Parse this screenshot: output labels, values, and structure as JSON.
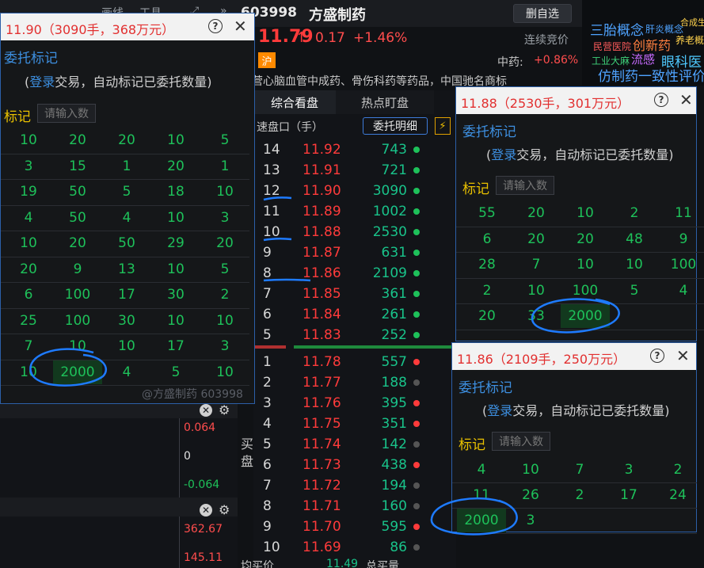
{
  "topbar": {
    "menu": [
      "画线",
      "工具"
    ],
    "code": "603998",
    "name": "方盛制药",
    "remove_btn": "删自选"
  },
  "quote": {
    "price": "11.79",
    "arrow": "↑",
    "change": "0.17",
    "change_pct": "+1.46%",
    "auction": "连续竞价",
    "exchange": "沪",
    "sector_label": "中药:",
    "sector_pct": "+0.86%",
    "business": "营心脑血管中成药、骨伤科药等药品，中国驰名商标"
  },
  "cloud": [
    {
      "t": "三胎概念",
      "c": "#4fa3ff"
    },
    {
      "t": "肝炎概念",
      "c": "#4fa3ff"
    },
    {
      "t": "合成生",
      "c": "#ffd24d"
    },
    {
      "t": "民营医院",
      "c": "#ff5b5b"
    },
    {
      "t": "创新药",
      "c": "#ff7f3f"
    },
    {
      "t": "养老概",
      "c": "#ffd24d"
    },
    {
      "t": "工业大麻",
      "c": "#3fd27a"
    },
    {
      "t": "流感",
      "c": "#c86bff"
    },
    {
      "t": "眼科医",
      "c": "#4fc9ff"
    },
    {
      "t": "仿制药一致性评价",
      "c": "#4fa3ff"
    }
  ],
  "tabs": [
    "综合看盘",
    "热点盯盘"
  ],
  "orderbook": {
    "header": "速盘口（手）",
    "detail_btn": "委托明细",
    "bolt": "⚡",
    "asks": [
      {
        "lv": "14",
        "px": "11.92",
        "vol": "743",
        "dot": "g"
      },
      {
        "lv": "13",
        "px": "11.91",
        "vol": "721",
        "dot": "g"
      },
      {
        "lv": "12",
        "px": "11.90",
        "vol": "3090",
        "dot": "g"
      },
      {
        "lv": "11",
        "px": "11.89",
        "vol": "1002",
        "dot": "g"
      },
      {
        "lv": "10",
        "px": "11.88",
        "vol": "2530",
        "dot": "g"
      },
      {
        "lv": "9",
        "px": "11.87",
        "vol": "631",
        "dot": "g"
      },
      {
        "lv": "8",
        "px": "11.86",
        "vol": "2109",
        "dot": "g"
      },
      {
        "lv": "7",
        "px": "11.85",
        "vol": "361",
        "dot": "g"
      },
      {
        "lv": "6",
        "px": "11.84",
        "vol": "261",
        "dot": "g"
      },
      {
        "lv": "5",
        "px": "11.83",
        "vol": "252",
        "dot": "g"
      }
    ],
    "bids": [
      {
        "lv": "1",
        "px": "11.78",
        "vol": "557",
        "dot": "r"
      },
      {
        "lv": "2",
        "px": "11.77",
        "vol": "188",
        "dot": "k"
      },
      {
        "lv": "3",
        "px": "11.76",
        "vol": "395",
        "dot": "r"
      },
      {
        "lv": "4",
        "px": "11.75",
        "vol": "351",
        "dot": "r"
      },
      {
        "lv": "5",
        "px": "11.74",
        "vol": "142",
        "dot": "k"
      },
      {
        "lv": "6",
        "px": "11.73",
        "vol": "438",
        "dot": "r"
      },
      {
        "lv": "7",
        "px": "11.72",
        "vol": "194",
        "dot": "k"
      },
      {
        "lv": "8",
        "px": "11.71",
        "vol": "160",
        "dot": "k"
      },
      {
        "lv": "9",
        "px": "11.70",
        "vol": "595",
        "dot": "r"
      },
      {
        "lv": "10",
        "px": "11.69",
        "vol": "86",
        "dot": "k"
      }
    ],
    "buy_label": "买盘",
    "footer_label": "均买价",
    "footer_val": "11.49",
    "footer_label2": "总买量"
  },
  "left_panel": {
    "axis1": [
      "0.064",
      "0",
      "-0.064"
    ],
    "axis2": [
      "362.67",
      "145.11"
    ]
  },
  "popup1": {
    "title": "11.90（3090手，368万元）",
    "sub": "委托标记",
    "login": "登录",
    "desc": "交易，自动标记已委托数量)",
    "mark": "标记",
    "input_ph": "请输入数",
    "rows": [
      [
        "10",
        "20",
        "20",
        "10",
        "5"
      ],
      [
        "3",
        "15",
        "1",
        "20",
        "1"
      ],
      [
        "19",
        "50",
        "5",
        "18",
        "10"
      ],
      [
        "4",
        "50",
        "4",
        "10",
        "3"
      ],
      [
        "10",
        "20",
        "50",
        "29",
        "20"
      ],
      [
        "20",
        "9",
        "13",
        "10",
        "5"
      ],
      [
        "6",
        "100",
        "17",
        "30",
        "2"
      ],
      [
        "25",
        "100",
        "30",
        "10",
        "10"
      ],
      [
        "7",
        "10",
        "10",
        "17",
        "3"
      ],
      [
        "10",
        "2000",
        "4",
        "5",
        "10"
      ]
    ],
    "watermark": "@方盛制药 603998"
  },
  "popup2": {
    "title": "11.88（2530手，301万元）",
    "sub": "委托标记",
    "login": "登录",
    "desc": "交易，自动标记已委托数量)",
    "mark": "标记",
    "input_ph": "请输入数",
    "rows": [
      [
        "55",
        "20",
        "10",
        "2",
        "11"
      ],
      [
        "6",
        "20",
        "20",
        "48",
        "9"
      ],
      [
        "28",
        "7",
        "10",
        "10",
        "100"
      ],
      [
        "2",
        "10",
        "100",
        "5",
        "4"
      ],
      [
        "20",
        "33",
        "2000",
        "",
        ""
      ]
    ]
  },
  "popup3": {
    "title": "11.86（2109手，250万元）",
    "sub": "委托标记",
    "login": "登录",
    "desc": "交易，自动标记已委托数量)",
    "mark": "标记",
    "input_ph": "请输入数",
    "rows": [
      [
        "4",
        "10",
        "7",
        "3",
        "2"
      ],
      [
        "11",
        "26",
        "2",
        "17",
        "24"
      ],
      [
        "2000",
        "3",
        "",
        "",
        ""
      ]
    ]
  },
  "help_glyph": "?",
  "close_glyph": "✕"
}
